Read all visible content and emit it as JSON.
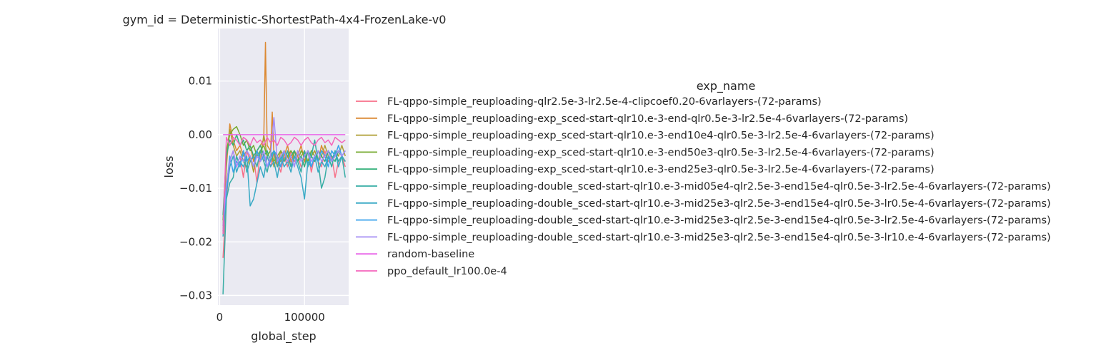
{
  "chart_data": {
    "type": "line",
    "title": "gym_id = Deterministic-ShortestPath-4x4-FrozenLake-v0",
    "xlabel": "global_step",
    "ylabel": "loss",
    "xlim": [
      -2000,
      152000
    ],
    "ylim": [
      -0.0318,
      0.0198
    ],
    "x_ticks": [
      0,
      100000
    ],
    "x_tick_labels": [
      "0",
      "100000"
    ],
    "y_ticks": [
      0.01,
      0.0,
      -0.01,
      -0.02,
      -0.03
    ],
    "y_tick_labels": [
      "0.01",
      "0.00",
      "−0.01",
      "−0.02",
      "−0.03"
    ],
    "grid": true,
    "legend_title": "exp_name",
    "legend_position": "right",
    "series": [
      {
        "name": "FL-qppo-simple_reuploading-qlr2.5e-3-lr2.5e-4-clipcoef0.20-6varlayers-(72-params)",
        "color": "#f77189",
        "x": [
          4000,
          8000,
          12000,
          16000,
          20000,
          24000,
          28000,
          32000,
          36000,
          40000,
          44000,
          48000,
          52000,
          56000,
          60000,
          64000,
          68000,
          72000,
          76000,
          80000,
          84000,
          88000,
          92000,
          96000,
          100000,
          104000,
          108000,
          112000,
          116000,
          120000,
          124000,
          128000,
          132000,
          136000,
          140000,
          144000,
          148000
        ],
        "values": [
          -0.023,
          -0.012,
          -0.005,
          -0.003,
          -0.006,
          -0.004,
          -0.008,
          -0.003,
          -0.005,
          -0.004,
          -0.009,
          -0.003,
          -0.005,
          -0.004,
          -0.006,
          -0.003,
          -0.005,
          -0.007,
          -0.004,
          -0.006,
          -0.003,
          -0.005,
          -0.004,
          -0.006,
          -0.005,
          -0.003,
          -0.007,
          -0.004,
          -0.005,
          -0.006,
          -0.003,
          -0.005,
          -0.004,
          -0.008,
          -0.005,
          -0.004,
          -0.006
        ]
      },
      {
        "name": "FL-qppo-simple_reuploading-exp_sced-start-qlr10.e-3-end-qlr0.5e-3-lr2.5e-4-6varlayers-(72-params)",
        "color": "#dc8932",
        "x": [
          4000,
          8000,
          12000,
          16000,
          20000,
          24000,
          28000,
          32000,
          36000,
          40000,
          44000,
          48000,
          52000,
          54000,
          56000,
          60000,
          62000,
          64000,
          68000,
          72000,
          76000,
          80000,
          84000,
          88000,
          92000,
          96000,
          100000,
          104000,
          108000,
          112000,
          116000,
          120000,
          124000,
          128000,
          132000,
          136000,
          140000,
          144000,
          148000
        ],
        "values": [
          -0.018,
          -0.006,
          0.002,
          -0.001,
          -0.003,
          -0.002,
          -0.004,
          -0.003,
          -0.002,
          -0.005,
          -0.003,
          -0.002,
          -0.001,
          0.0172,
          -0.002,
          -0.003,
          0.0042,
          -0.004,
          -0.006,
          -0.003,
          -0.004,
          -0.002,
          -0.005,
          -0.003,
          -0.004,
          -0.002,
          -0.005,
          -0.003,
          -0.004,
          -0.003,
          -0.005,
          -0.002,
          -0.004,
          -0.003,
          -0.005,
          -0.004,
          -0.003,
          -0.004,
          -0.005
        ]
      },
      {
        "name": "FL-qppo-simple_reuploading-exp_sced-start-qlr10.e-3-end10e4-qlr0.5e-3-lr2.5e-4-6varlayers-(72-params)",
        "color": "#ae9d31",
        "x": [
          4000,
          8000,
          12000,
          16000,
          20000,
          24000,
          28000,
          32000,
          36000,
          40000,
          44000,
          48000,
          52000,
          56000,
          60000,
          64000,
          68000,
          72000,
          76000,
          80000,
          84000,
          88000,
          92000,
          96000,
          100000,
          104000,
          108000,
          112000,
          116000,
          120000,
          124000,
          128000,
          132000,
          136000,
          140000,
          144000,
          148000
        ],
        "values": [
          -0.017,
          -0.004,
          0.001,
          -0.002,
          -0.004,
          -0.003,
          -0.005,
          -0.006,
          -0.004,
          -0.007,
          -0.003,
          -0.005,
          0.0,
          -0.004,
          -0.003,
          -0.006,
          -0.004,
          -0.005,
          -0.003,
          -0.004,
          -0.006,
          -0.003,
          -0.005,
          -0.004,
          -0.003,
          -0.005,
          -0.004,
          -0.003,
          -0.005,
          -0.004,
          -0.002,
          -0.004,
          -0.005,
          -0.003,
          -0.004,
          -0.002,
          -0.004
        ]
      },
      {
        "name": "FL-qppo-simple_reuploading-exp_sced-start-qlr10.e-3-end50e3-qlr0.5e-3-lr2.5e-4-6varlayers-(72-params)",
        "color": "#77ab31",
        "x": [
          4000,
          8000,
          12000,
          16000,
          20000,
          24000,
          28000,
          32000,
          36000,
          40000,
          44000,
          48000,
          52000,
          56000,
          60000,
          64000,
          68000,
          72000,
          76000,
          80000,
          84000,
          88000,
          92000,
          96000,
          100000,
          104000,
          108000,
          112000,
          116000,
          120000,
          124000,
          128000,
          132000,
          136000,
          140000,
          144000,
          148000
        ],
        "values": [
          -0.016,
          -0.003,
          0.0,
          0.001,
          0.0015,
          0.0,
          -0.002,
          -0.001,
          -0.003,
          -0.002,
          -0.004,
          -0.003,
          -0.002,
          -0.004,
          -0.003,
          -0.005,
          -0.004,
          -0.003,
          -0.005,
          -0.004,
          -0.003,
          -0.004,
          -0.005,
          -0.003,
          -0.004,
          -0.005,
          -0.003,
          -0.004,
          -0.005,
          -0.003,
          -0.004,
          -0.003,
          -0.005,
          -0.004,
          -0.003,
          -0.004,
          -0.005
        ]
      },
      {
        "name": "FL-qppo-simple_reuploading-exp_sced-start-qlr10.e-3-end25e3-qlr0.5e-3-lr2.5e-4-6varlayers-(72-params)",
        "color": "#33b07a",
        "x": [
          4000,
          8000,
          12000,
          16000,
          20000,
          24000,
          28000,
          32000,
          36000,
          40000,
          44000,
          48000,
          52000,
          56000,
          60000,
          64000,
          68000,
          72000,
          76000,
          80000,
          84000,
          88000,
          92000,
          96000,
          100000,
          104000,
          108000,
          112000,
          116000,
          120000,
          124000,
          128000,
          132000,
          136000,
          140000,
          144000,
          148000
        ],
        "values": [
          -0.015,
          -0.004,
          -0.001,
          -0.002,
          0.0,
          -0.002,
          -0.001,
          -0.003,
          -0.002,
          -0.004,
          -0.003,
          -0.002,
          -0.004,
          -0.003,
          -0.005,
          -0.003,
          -0.004,
          -0.006,
          -0.003,
          -0.005,
          -0.004,
          -0.003,
          -0.005,
          -0.004,
          -0.006,
          -0.003,
          -0.004,
          -0.005,
          -0.003,
          -0.004,
          -0.005,
          -0.003,
          -0.004,
          -0.005,
          -0.003,
          -0.004,
          -0.005
        ]
      },
      {
        "name": "FL-qppo-simple_reuploading-double_sced-start-qlr10.e-3-mid05e4-qlr2.5e-3-end15e4-qlr0.5e-3-lr2.5e-4-6varlayers-(72-params)",
        "color": "#36ada4",
        "x": [
          4000,
          8000,
          12000,
          16000,
          20000,
          24000,
          28000,
          32000,
          36000,
          40000,
          44000,
          48000,
          52000,
          56000,
          60000,
          64000,
          68000,
          72000,
          76000,
          80000,
          84000,
          88000,
          92000,
          96000,
          100000,
          104000,
          108000,
          112000,
          116000,
          120000,
          124000,
          128000,
          132000,
          136000,
          140000,
          144000,
          148000
        ],
        "values": [
          -0.0298,
          -0.012,
          -0.009,
          -0.008,
          -0.004,
          -0.006,
          -0.003,
          -0.007,
          -0.005,
          -0.004,
          -0.006,
          -0.003,
          -0.005,
          -0.007,
          -0.004,
          -0.003,
          -0.006,
          -0.004,
          -0.005,
          -0.003,
          -0.006,
          -0.004,
          -0.005,
          -0.007,
          -0.003,
          -0.006,
          -0.004,
          -0.001,
          -0.005,
          -0.01,
          -0.008,
          -0.004,
          -0.006,
          -0.003,
          -0.005,
          -0.004,
          -0.008
        ]
      },
      {
        "name": "FL-qppo-simple_reuploading-double_sced-start-qlr10.e-3-mid25e3-qlr2.5e-3-end15e4-qlr0.5e-3-lr0.5e-4-6varlayers-(72-params)",
        "color": "#38a9c5",
        "x": [
          4000,
          8000,
          12000,
          16000,
          20000,
          24000,
          28000,
          32000,
          36000,
          40000,
          44000,
          48000,
          52000,
          56000,
          60000,
          64000,
          68000,
          72000,
          76000,
          80000,
          84000,
          88000,
          92000,
          96000,
          100000,
          104000,
          108000,
          112000,
          116000,
          120000,
          124000,
          128000,
          132000,
          136000,
          140000,
          144000,
          148000
        ],
        "values": [
          -0.019,
          -0.011,
          -0.006,
          -0.004,
          -0.007,
          -0.005,
          -0.006,
          -0.004,
          -0.0133,
          -0.012,
          -0.009,
          -0.006,
          -0.008,
          -0.004,
          -0.006,
          -0.005,
          -0.008,
          -0.004,
          -0.006,
          -0.005,
          -0.007,
          -0.004,
          -0.006,
          -0.008,
          -0.012,
          -0.005,
          -0.006,
          -0.004,
          -0.007,
          -0.005,
          -0.006,
          -0.004,
          -0.005,
          -0.003,
          -0.006,
          -0.004,
          -0.005
        ]
      },
      {
        "name": "FL-qppo-simple_reuploading-double_sced-start-qlr10.e-3-mid25e3-qlr2.5e-3-end15e4-qlr0.5e-3-lr2.5e-4-6varlayers-(72-params)",
        "color": "#3ba3ec",
        "x": [
          4000,
          8000,
          12000,
          16000,
          20000,
          24000,
          28000,
          32000,
          36000,
          40000,
          44000,
          48000,
          52000,
          56000,
          60000,
          64000,
          68000,
          72000,
          76000,
          80000,
          84000,
          88000,
          92000,
          96000,
          100000,
          104000,
          108000,
          112000,
          116000,
          120000,
          124000,
          128000,
          132000,
          136000,
          140000,
          144000,
          148000
        ],
        "values": [
          -0.018,
          -0.01,
          -0.004,
          -0.007,
          -0.005,
          -0.006,
          -0.003,
          -0.005,
          -0.004,
          -0.006,
          -0.003,
          -0.005,
          -0.004,
          -0.006,
          -0.005,
          -0.003,
          -0.004,
          -0.006,
          -0.003,
          -0.005,
          -0.004,
          -0.006,
          -0.003,
          -0.005,
          -0.004,
          -0.003,
          -0.006,
          -0.004,
          -0.005,
          -0.003,
          -0.004,
          -0.006,
          -0.003,
          -0.004,
          -0.002,
          -0.004,
          -0.003
        ]
      },
      {
        "name": "FL-qppo-simple_reuploading-double_sced-start-qlr10.e-3-mid25e3-qlr2.5e-3-end15e4-qlr0.5e-3-lr10.e-4-6varlayers-(72-params)",
        "color": "#a48cf4",
        "x": [
          4000,
          8000,
          12000,
          16000,
          20000,
          24000,
          28000,
          32000,
          36000,
          40000,
          44000,
          48000,
          52000,
          56000,
          60000,
          64000,
          68000,
          72000,
          76000,
          80000,
          84000,
          88000,
          92000,
          96000,
          100000,
          104000,
          108000,
          112000,
          116000,
          120000,
          124000,
          128000,
          132000,
          136000,
          140000,
          144000,
          148000
        ],
        "values": [
          -0.017,
          -0.009,
          -0.005,
          -0.003,
          -0.006,
          -0.004,
          -0.005,
          -0.003,
          -0.004,
          -0.006,
          -0.004,
          -0.005,
          -0.003,
          -0.006,
          -0.004,
          0.0032,
          -0.005,
          -0.004,
          -0.003,
          -0.005,
          -0.004,
          -0.006,
          -0.003,
          -0.005,
          -0.004,
          -0.003,
          -0.005,
          -0.004,
          -0.003,
          -0.005,
          -0.004,
          -0.003,
          -0.005,
          -0.004,
          -0.003,
          -0.004,
          -0.003
        ]
      },
      {
        "name": "random-baseline",
        "color": "#e866e8",
        "x": [
          4000,
          148000
        ],
        "values": [
          0.0,
          0.0
        ]
      },
      {
        "name": "ppo_default_lr100.0e-4",
        "color": "#f565bb",
        "x": [
          4000,
          8000,
          12000,
          16000,
          20000,
          24000,
          28000,
          32000,
          36000,
          40000,
          44000,
          48000,
          52000,
          56000,
          60000,
          64000,
          68000,
          72000,
          76000,
          80000,
          84000,
          88000,
          92000,
          96000,
          100000,
          104000,
          108000,
          112000,
          116000,
          120000,
          124000,
          128000,
          132000,
          136000,
          140000,
          144000,
          148000
        ],
        "values": [
          -0.0185,
          -0.0005,
          -0.002,
          -0.0005,
          -0.001,
          -0.002,
          -0.0005,
          -0.001,
          -0.002,
          -0.0005,
          -0.0015,
          -0.001,
          -0.002,
          -0.0005,
          -0.0015,
          -0.001,
          -0.002,
          -0.0005,
          -0.001,
          -0.002,
          -0.0015,
          -0.0005,
          -0.001,
          -0.002,
          -0.001,
          -0.0005,
          -0.0015,
          -0.002,
          -0.001,
          -0.0005,
          -0.0015,
          -0.001,
          -0.002,
          -0.0005,
          -0.001,
          -0.0015,
          -0.001
        ]
      }
    ]
  }
}
